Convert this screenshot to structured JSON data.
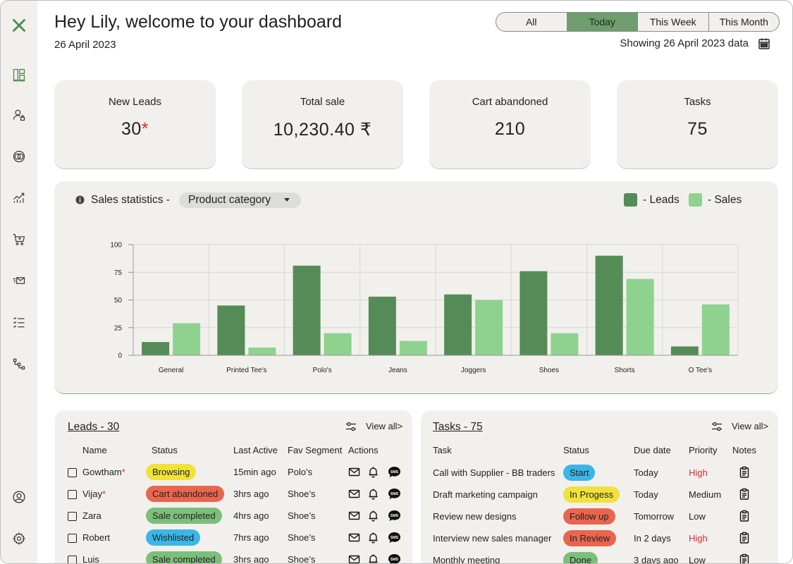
{
  "header": {
    "greeting": "Hey Lily, welcome to your dashboard",
    "date": "26 April 2023",
    "filters": [
      "All",
      "Today",
      "This Week",
      "This Month"
    ],
    "active_filter": "Today",
    "showing": "Showing 26 April 2023 data"
  },
  "sidebar": {
    "items": [
      "logo-icon",
      "dashboard-icon",
      "user-lock-icon",
      "overlap-circles-icon",
      "trend-chart-icon",
      "cart-icon",
      "mail-icon",
      "checklist-icon",
      "workflow-icon",
      "account-icon",
      "gear-icon"
    ]
  },
  "stats": [
    {
      "label": "New Leads",
      "value": "30",
      "star": "*"
    },
    {
      "label": "Total sale",
      "value": "10,230.40 ₹"
    },
    {
      "label": "Cart abandoned",
      "value": "210"
    },
    {
      "label": "Tasks",
      "value": "75"
    }
  ],
  "chart_panel": {
    "title": "Sales statistics -",
    "dropdown": "Product category",
    "legend_leads": "- Leads",
    "legend_sales": "- Sales"
  },
  "colors": {
    "leads": "#558b57",
    "sales": "#8fd28f",
    "accent": "#6f9d6d",
    "high": "#d32f2f",
    "browsing": "#f0e23a",
    "cart_abandoned": "#e8664e",
    "sale_completed": "#7cbf7b",
    "wishlisted": "#3bb6e6",
    "in_progress": "#f0e23a"
  },
  "chart_data": {
    "type": "bar",
    "categories": [
      "General",
      "Printed Tee's",
      "Polo's",
      "Jeans",
      "Joggers",
      "Shoes",
      "Shorts",
      "O Tee's"
    ],
    "series": [
      {
        "name": "Leads",
        "values": [
          12,
          45,
          81,
          53,
          55,
          76,
          90,
          8
        ]
      },
      {
        "name": "Sales",
        "values": [
          29,
          7,
          20,
          13,
          50,
          20,
          69,
          46
        ]
      }
    ],
    "yticks": [
      "0",
      "25",
      "50",
      "75",
      "100"
    ],
    "ylim": [
      0,
      100
    ],
    "grid": true,
    "legend": "top-right"
  },
  "leads": {
    "title": "Leads - 30",
    "view_all": "View all>",
    "columns": [
      "Name",
      "Status",
      "Last Active",
      "Fav Segment",
      "Actions"
    ],
    "rows": [
      {
        "name": "Gowtham",
        "star": "*",
        "status": "Browsing",
        "status_color": "#f0e23a",
        "last_active": "15min ago",
        "segment": "Polo’s"
      },
      {
        "name": "Vijay",
        "star": "*",
        "status": "Cart abandoned",
        "status_color": "#e8664e",
        "last_active": "3hrs ago",
        "segment": "Shoe’s"
      },
      {
        "name": "Zara",
        "star": "",
        "status": "Sale completed",
        "status_color": "#7cbf7b",
        "last_active": "4hrs ago",
        "segment": "Shoe’s"
      },
      {
        "name": "Robert",
        "star": "",
        "status": "Wishlisted",
        "status_color": "#3bb6e6",
        "last_active": "7hrs ago",
        "segment": "Shoe’s"
      },
      {
        "name": "Luis",
        "star": "",
        "status": "Sale completed",
        "status_color": "#7cbf7b",
        "last_active": "3hrs ago",
        "segment": "Shoe’s"
      }
    ],
    "sms_label": "SMS"
  },
  "tasks": {
    "title": "Tasks - 75",
    "view_all": "View all>",
    "columns": [
      "Task",
      "Status",
      "Due date",
      "Priority",
      "Notes"
    ],
    "rows": [
      {
        "task": "Call with Supplier - BB traders",
        "status": "Start",
        "status_color": "#3bb6e6",
        "due": "Today",
        "priority": "High",
        "high": true
      },
      {
        "task": "Draft marketing campaign",
        "status": "In Progess",
        "status_color": "#f0e23a",
        "due": "Today",
        "priority": "Medium",
        "high": false
      },
      {
        "task": "Review new designs",
        "status": "Follow up",
        "status_color": "#e8664e",
        "due": "Tomorrow",
        "priority": "Low",
        "high": false
      },
      {
        "task": "Interview new sales manager",
        "status": "In Review",
        "status_color": "#e8664e",
        "due": "In 2 days",
        "priority": "High",
        "high": true
      },
      {
        "task": "Monthly meeting",
        "status": "Done",
        "status_color": "#7cbf7b",
        "due": "3 days ago",
        "priority": "Low",
        "high": false
      }
    ]
  }
}
